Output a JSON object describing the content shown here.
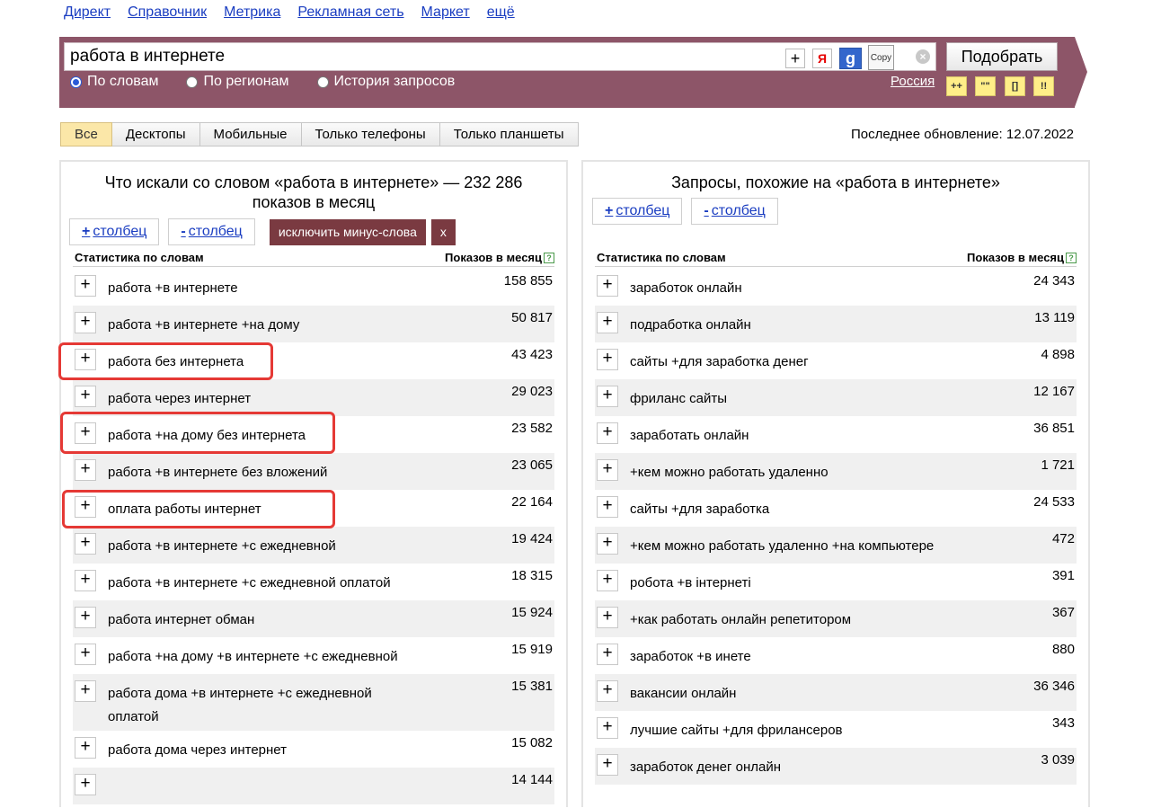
{
  "topnav": [
    "Директ",
    "Справочник",
    "Метрика",
    "Рекламная сеть",
    "Маркет",
    "ещё"
  ],
  "search": {
    "value": "работа в интернете",
    "plus": "+",
    "ya": "Я",
    "g": "g",
    "copy": "Copy",
    "clear": "×",
    "button": "Подобрать"
  },
  "radios": [
    {
      "label": "По словам",
      "selected": true
    },
    {
      "label": "По регионам",
      "selected": false
    },
    {
      "label": "История запросов",
      "selected": false
    }
  ],
  "region": "Россия",
  "mini_buttons": [
    "++",
    "\"\"",
    "[]",
    "!!"
  ],
  "tabs": [
    {
      "label": "Все",
      "active": true
    },
    {
      "label": "Десктопы",
      "active": false
    },
    {
      "label": "Мобильные",
      "active": false
    },
    {
      "label": "Только телефоны",
      "active": false
    },
    {
      "label": "Только планшеты",
      "active": false
    }
  ],
  "last_update": "Последнее обновление: 12.07.2022",
  "left_panel": {
    "title": "Что искали со словом «работа в интернете» — 232 286 показов в месяц",
    "add_col": "столбец",
    "remove_col": "столбец",
    "add_sign": "+",
    "remove_sign": "-",
    "exclude_btn": "исключить минус-слова",
    "x_btn": "x",
    "col_phrase": "Статистика по словам",
    "col_count": "Показов в месяц",
    "help": "?",
    "rows": [
      {
        "phrase": "работа +в интернете",
        "count": "158 855"
      },
      {
        "phrase": "работа +в интернете +на дому",
        "count": "50 817"
      },
      {
        "phrase": "работа без интернета",
        "count": "43 423"
      },
      {
        "phrase": "работа через интернет",
        "count": "29 023"
      },
      {
        "phrase": "работа +на дому без интернета",
        "count": "23 582"
      },
      {
        "phrase": "работа +в интернете без вложений",
        "count": "23 065"
      },
      {
        "phrase": "оплата работы интернет",
        "count": "22 164"
      },
      {
        "phrase": "работа +в интернете +с ежедневной",
        "count": "19 424"
      },
      {
        "phrase": "работа +в интернете +с ежедневной оплатой",
        "count": "18 315"
      },
      {
        "phrase": "работа интернет обман",
        "count": "15 924"
      },
      {
        "phrase": "работа +на дому +в интернете +с ежедневной",
        "count": "15 919"
      },
      {
        "phrase": "работа дома +в интернете +с ежедневной оплатой",
        "count": "15 381"
      },
      {
        "phrase": "работа дома через интернет",
        "count": "15 082"
      },
      {
        "phrase": "",
        "count": "14 144"
      }
    ]
  },
  "right_panel": {
    "title": "Запросы, похожие на «работа в интернете»",
    "add_col": "столбец",
    "remove_col": "столбец",
    "add_sign": "+",
    "remove_sign": "-",
    "col_phrase": "Статистика по словам",
    "col_count": "Показов в месяц",
    "help": "?",
    "rows": [
      {
        "phrase": "заработок онлайн",
        "count": "24 343"
      },
      {
        "phrase": "подработка онлайн",
        "count": "13 119"
      },
      {
        "phrase": "сайты +для заработка денег",
        "count": "4 898"
      },
      {
        "phrase": "фриланс сайты",
        "count": "12 167"
      },
      {
        "phrase": "заработать онлайн",
        "count": "36 851"
      },
      {
        "phrase": "+кем можно работать удаленно",
        "count": "1 721"
      },
      {
        "phrase": "сайты +для заработка",
        "count": "24 533"
      },
      {
        "phrase": "+кем можно работать удаленно +на компьютере",
        "count": "472"
      },
      {
        "phrase": "робота +в інтернеті",
        "count": "391"
      },
      {
        "phrase": "+как работать онлайн репетитором",
        "count": "367"
      },
      {
        "phrase": "заработок +в инете",
        "count": "880"
      },
      {
        "phrase": "вакансии онлайн",
        "count": "36 346"
      },
      {
        "phrase": "лучшие сайты +для фрилансеров",
        "count": "343"
      },
      {
        "phrase": "заработок денег онлайн",
        "count": "3 039"
      }
    ]
  },
  "colors": {
    "band": "#8d5568",
    "link": "#1a3dc1",
    "exclude_btn": "#7a3a41",
    "highlight": "#e53935",
    "active_tab": "#fbe7a8"
  }
}
